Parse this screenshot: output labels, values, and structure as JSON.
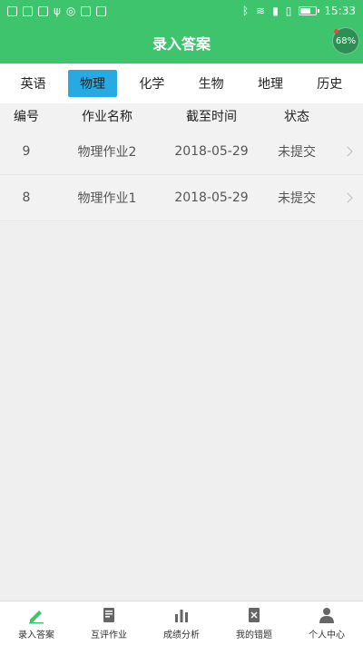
{
  "status_bar": {
    "time": "15:33",
    "battery_level": 0.7
  },
  "header": {
    "title": "录入答案",
    "battery_badge": "68%"
  },
  "tabs": [
    {
      "label": "英语",
      "active": false
    },
    {
      "label": "物理",
      "active": true
    },
    {
      "label": "化学",
      "active": false
    },
    {
      "label": "生物",
      "active": false
    },
    {
      "label": "地理",
      "active": false
    },
    {
      "label": "历史",
      "active": false
    }
  ],
  "table": {
    "headers": {
      "id": "编号",
      "name": "作业名称",
      "deadline": "截至时间",
      "status": "状态"
    },
    "rows": [
      {
        "id": "9",
        "name": "物理作业2",
        "deadline": "2018-05-29",
        "status": "未提交"
      },
      {
        "id": "8",
        "name": "物理作业1",
        "deadline": "2018-05-29",
        "status": "未提交"
      }
    ]
  },
  "bottom_nav": [
    {
      "label": "录入答案",
      "icon": "pencil-icon",
      "active": true
    },
    {
      "label": "互评作业",
      "icon": "document-edit-icon",
      "active": false
    },
    {
      "label": "成绩分析",
      "icon": "bar-chart-icon",
      "active": false
    },
    {
      "label": "我的错题",
      "icon": "wrong-book-icon",
      "active": false
    },
    {
      "label": "个人中心",
      "icon": "user-icon",
      "active": false
    }
  ],
  "colors": {
    "primary": "#3ec46d",
    "active_tab": "#27a9e1"
  }
}
